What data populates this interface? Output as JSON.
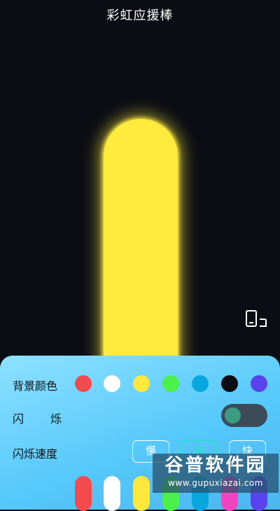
{
  "app": {
    "title": "彩虹应援棒"
  },
  "stick": {
    "color": "#ffea3d"
  },
  "panel": {
    "background_label": "背景颜色",
    "flash_label_left": "闪",
    "flash_label_right": "烁",
    "speed_label": "闪烁速度",
    "colors": [
      "#f24a4d",
      "#ffffff",
      "#ffe83c",
      "#4cf04a",
      "#09a7e0",
      "#0b0d14",
      "#5a43ef"
    ],
    "flash_on": false,
    "speed_options": [
      {
        "label": "慢",
        "active": false
      },
      {
        "label": "中",
        "active": true
      },
      {
        "label": "快",
        "active": false
      }
    ],
    "stick_colors": [
      "#f24a4d",
      "#ffffff",
      "#ffe83c",
      "#4cf04a",
      "#09a7e0",
      "#f044c0",
      "#5a43ef"
    ]
  },
  "watermark": {
    "main": "谷普软件园",
    "sub": "www.gupuxiazai.com"
  }
}
